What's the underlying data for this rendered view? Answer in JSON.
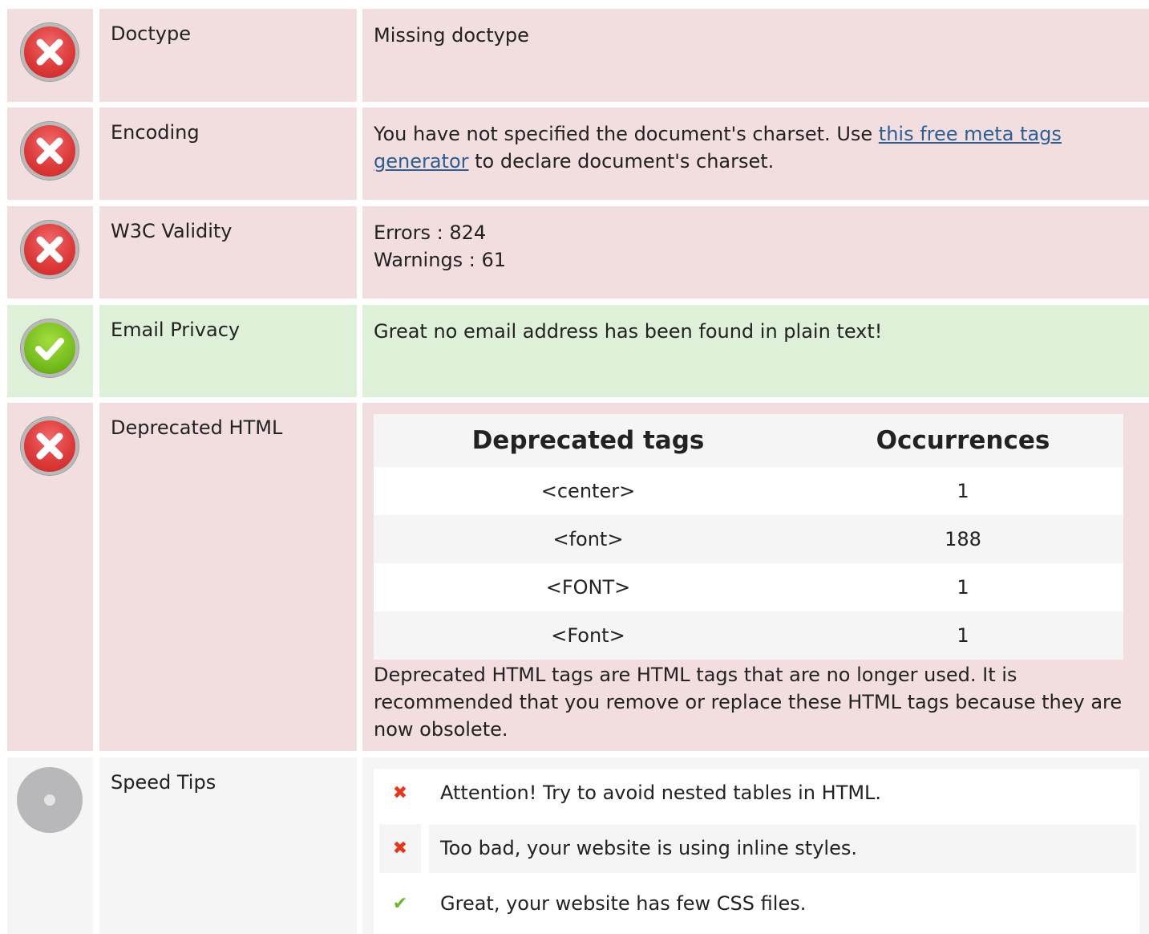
{
  "rows": {
    "doctype": {
      "status": "error",
      "label": "Doctype",
      "text": "Missing doctype"
    },
    "encoding": {
      "status": "error",
      "label": "Encoding",
      "text_before": "You have not specified the document's charset. Use ",
      "link": "this free meta tags generator",
      "text_after": " to declare document's charset."
    },
    "w3c": {
      "status": "error",
      "label": "W3C Validity",
      "errors": "Errors : 824",
      "warnings": "Warnings : 61"
    },
    "email": {
      "status": "ok",
      "label": "Email Privacy",
      "text": "Great no email address has been found in plain text!"
    },
    "deprecated": {
      "status": "error",
      "label": "Deprecated HTML",
      "headers": [
        "Deprecated tags",
        "Occurrences"
      ],
      "tags": [
        {
          "tag": "<center>",
          "count": "1"
        },
        {
          "tag": "<font>",
          "count": "188"
        },
        {
          "tag": "<FONT>",
          "count": "1"
        },
        {
          "tag": "<Font>",
          "count": "1"
        }
      ],
      "note": "Deprecated HTML tags are HTML tags that are no longer used. It is recommended that you remove or replace these HTML tags because they are now obsolete."
    },
    "speed": {
      "status": "neutral",
      "label": "Speed Tips",
      "tips": [
        {
          "status": "bad",
          "icon": "cross-icon",
          "text": "Attention! Try to avoid nested tables in HTML."
        },
        {
          "status": "bad",
          "icon": "cross-icon",
          "text": "Too bad, your website is using inline styles."
        },
        {
          "status": "good",
          "icon": "check-icon",
          "text": "Great, your website has few CSS files."
        }
      ]
    }
  },
  "colors": {
    "error_bg": "#f2dedf",
    "ok_bg": "#dff0d8",
    "neutral_bg": "#f5f5f5",
    "link": "#2b5f94",
    "cross": "#e8361e",
    "check": "#6bb82a"
  }
}
